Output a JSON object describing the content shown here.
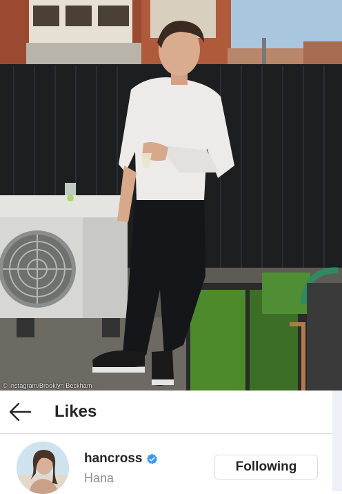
{
  "photo": {
    "credit": "© Instagram/Brooklyn Beckham",
    "alt": "Man in white long-sleeve top and black trousers standing on a rooftop next to an air conditioning unit and a vegetable planter"
  },
  "header": {
    "back_icon": "arrow-left-icon",
    "title": "Likes"
  },
  "likes": [
    {
      "username": "hancross",
      "display_name": "Hana",
      "verified": true,
      "button_label": "Following"
    }
  ],
  "colors": {
    "verified_badge": "#3897f0",
    "text_primary": "#262626",
    "text_secondary": "#8e8e8e",
    "border": "#dbdbdb"
  }
}
